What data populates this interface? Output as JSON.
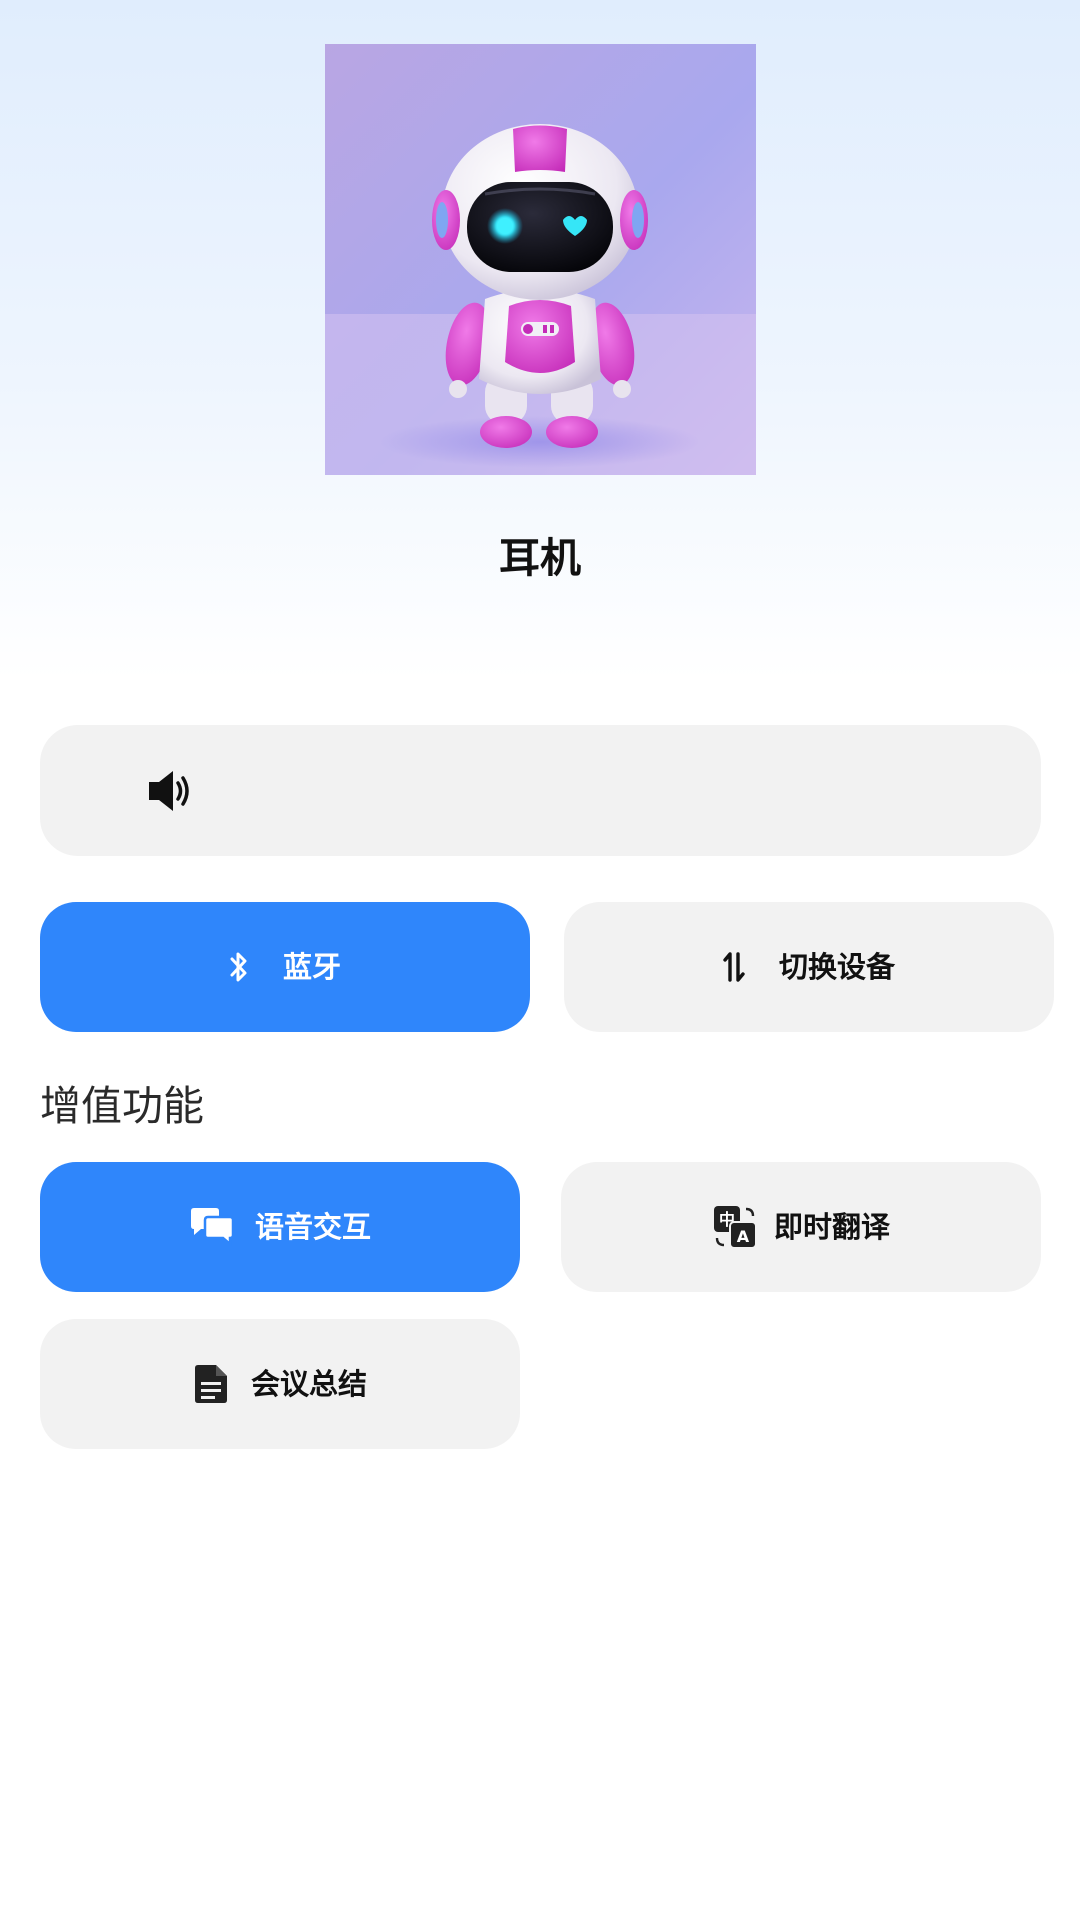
{
  "device": {
    "name": "耳机",
    "image_alt": "robot"
  },
  "volume": {
    "icon": "speaker-icon"
  },
  "controls": {
    "bluetooth_label": "蓝牙",
    "bluetooth_icon": "bluetooth-icon",
    "switch_device_label": "切换设备",
    "switch_device_icon": "swap-vertical-icon"
  },
  "value_added": {
    "title": "增值功能",
    "items": [
      {
        "label": "语音交互",
        "icon": "chat-bubbles-icon",
        "active": true
      },
      {
        "label": "即时翻译",
        "icon": "translate-icon",
        "active": false
      },
      {
        "label": "会议总结",
        "icon": "document-icon",
        "active": false
      }
    ]
  },
  "colors": {
    "accent": "#2f86fb",
    "button_bg": "#f2f2f2"
  }
}
